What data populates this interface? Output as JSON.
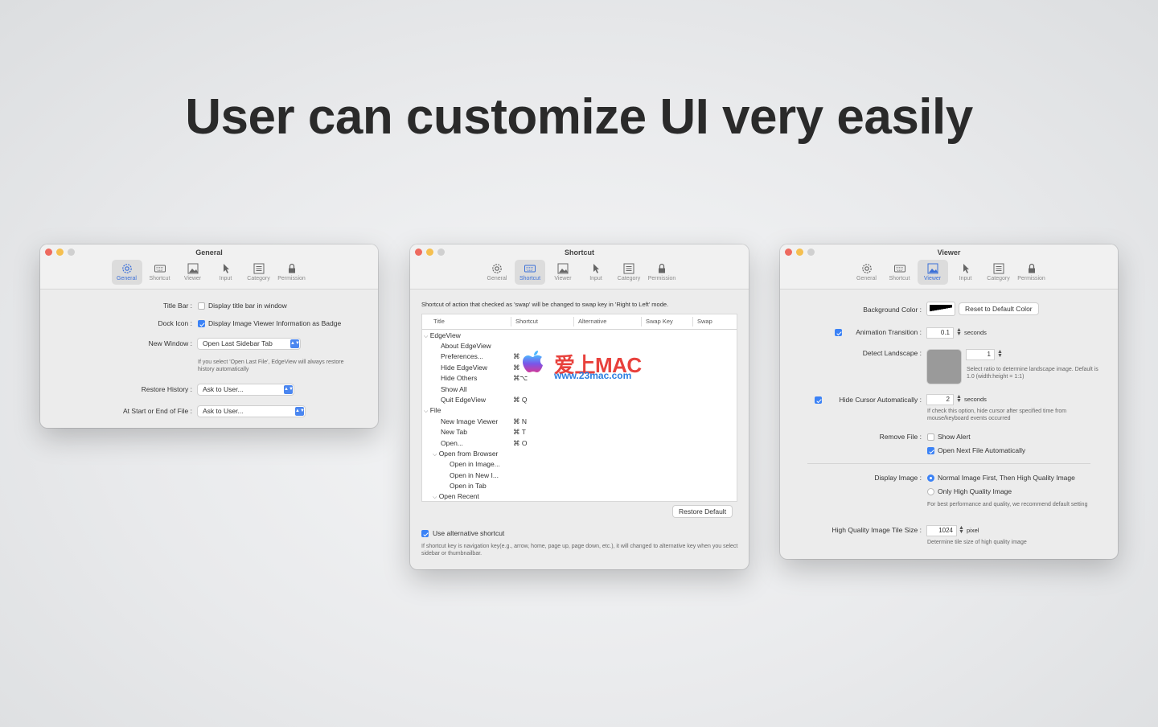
{
  "headline": "User can customize UI very easily",
  "tabs": [
    "General",
    "Shortcut",
    "Viewer",
    "Input",
    "Category",
    "Permission"
  ],
  "general": {
    "title": "General",
    "title_bar_label": "Title Bar :",
    "title_bar_option": "Display title bar in window",
    "dock_icon_label": "Dock Icon :",
    "dock_icon_option": "Display Image Viewer Information as Badge",
    "new_window_label": "New Window :",
    "new_window_value": "Open Last Sidebar Tab",
    "new_window_note": "If you select 'Open Last File', EdgeView will always restore history automatically",
    "restore_history_label": "Restore History :",
    "restore_history_value": "Ask to User...",
    "start_end_label": "At Start or End of File :",
    "start_end_value": "Ask to User..."
  },
  "shortcut": {
    "title": "Shortcut",
    "intro": "Shortcut of action that checked as 'swap' will be changed to swap key in 'Right to Left' mode.",
    "columns": [
      "Title",
      "Shortcut",
      "Alternative",
      "Swap Key",
      "Swap"
    ],
    "rows": [
      {
        "title": "EdgeView",
        "shortcut": ""
      },
      {
        "title": "About EdgeView",
        "shortcut": ""
      },
      {
        "title": "Preferences...",
        "shortcut": "⌘"
      },
      {
        "title": "Hide EdgeView",
        "shortcut": "⌘"
      },
      {
        "title": "Hide Others",
        "shortcut": "⌘⌥"
      },
      {
        "title": "Show All",
        "shortcut": ""
      },
      {
        "title": "Quit EdgeView",
        "shortcut": "⌘ Q"
      },
      {
        "title": "File",
        "shortcut": ""
      },
      {
        "title": "New Image Viewer",
        "shortcut": "⌘ N"
      },
      {
        "title": "New Tab",
        "shortcut": "⌘ T"
      },
      {
        "title": "Open...",
        "shortcut": "⌘ O"
      },
      {
        "title": "Open from Browser",
        "shortcut": ""
      },
      {
        "title": "Open in Image...",
        "shortcut": ""
      },
      {
        "title": "Open in New I...",
        "shortcut": ""
      },
      {
        "title": "Open in Tab",
        "shortcut": ""
      },
      {
        "title": "Open Recent",
        "shortcut": ""
      }
    ],
    "restore_default": "Restore Default",
    "use_alt_label": "Use alternative shortcut",
    "use_alt_note": "If shortcut key is navigation key(e.g., arrow, home, page up, page down, etc.), it will changed to alternative key when you select sidebar or thumbnailbar."
  },
  "viewer": {
    "title": "Viewer",
    "bg_color_label": "Background Color :",
    "reset_color": "Reset to Default Color",
    "anim_label": "Animation Transition :",
    "anim_value": "0.1",
    "anim_unit": "seconds",
    "detect_label": "Detect Landscape :",
    "detect_value": "1",
    "detect_note": "Select ratio to determine landscape image. Default is 1.0 (width:height = 1:1)",
    "hide_cursor_label": "Hide Cursor Automatically :",
    "hide_cursor_value": "2",
    "hide_cursor_unit": "seconds",
    "hide_cursor_note": "If check this option, hide cursor after specified time from mouse/keyboard events occurred",
    "remove_file_label": "Remove File :",
    "show_alert": "Show Alert",
    "open_next": "Open Next File Automatically",
    "display_image_label": "Display Image :",
    "normal_first": "Normal Image First, Then High Quality Image",
    "only_high": "Only High Quality Image",
    "display_note": "For best performance and quality, we recommend default setting",
    "tile_label": "High Quality Image Tile Size :",
    "tile_value": "1024",
    "tile_unit": "pixel",
    "tile_note": "Determine tile size of high quality image"
  },
  "watermark": {
    "text": "爱上MAC",
    "url": "www.23mac.com"
  }
}
